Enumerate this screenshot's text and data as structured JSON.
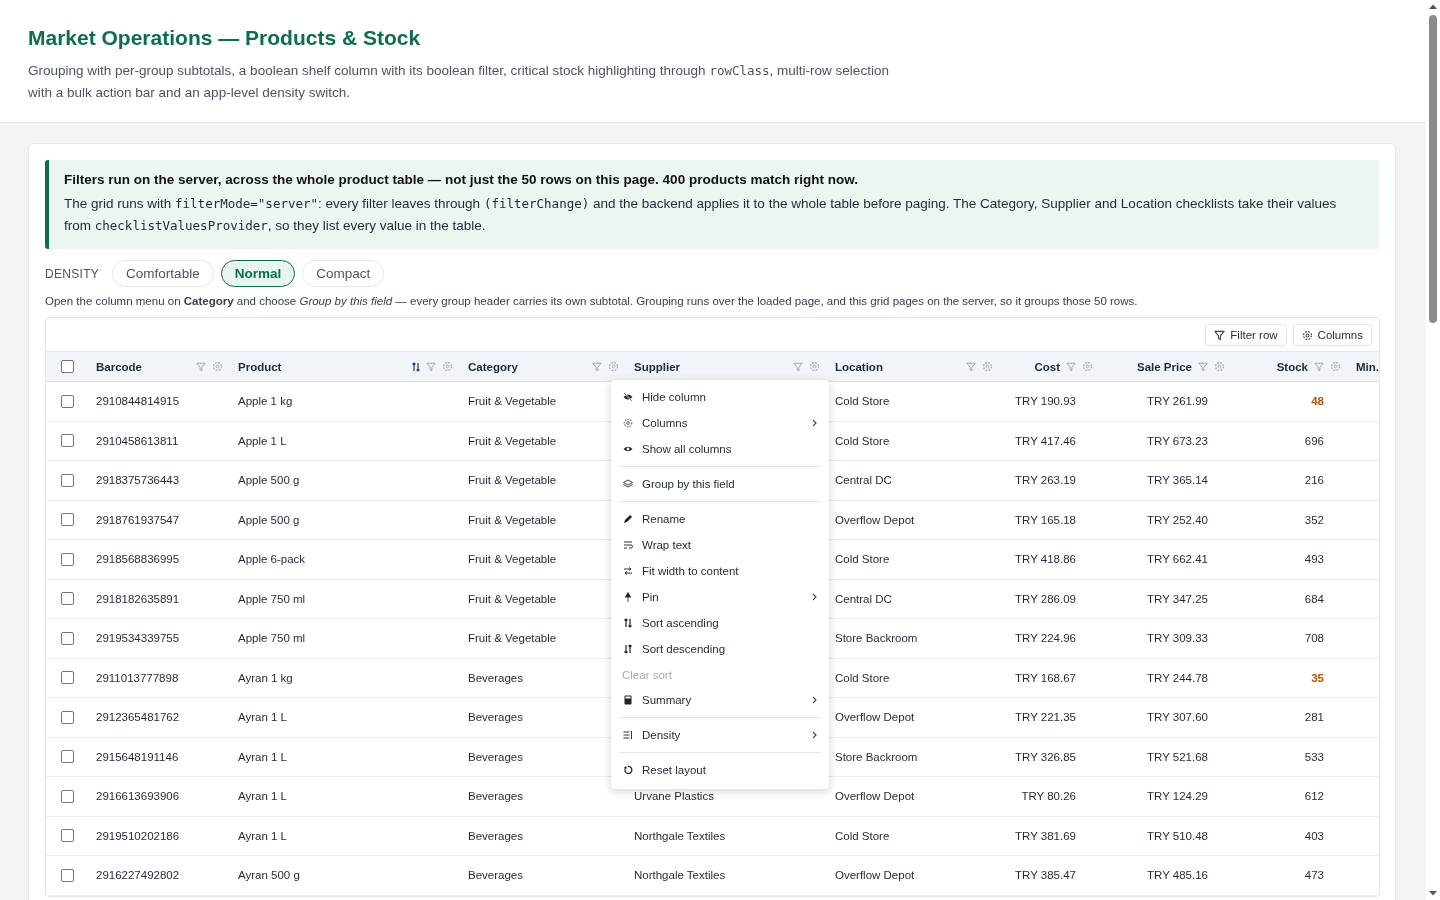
{
  "header": {
    "title": "Market Operations — Products & Stock",
    "description": [
      {
        "kind": "text",
        "text": "Grouping with per-group subtotals, a boolean shelf column with its boolean filter, critical stock highlighting through "
      },
      {
        "kind": "code",
        "text": "rowClass"
      },
      {
        "kind": "text",
        "text": ", multi-row selection with a bulk action bar and an app-level density switch."
      }
    ]
  },
  "notice": {
    "heading": "Filters run on the server, across the whole product table — not just the 50 rows on this page. 400 products match right now.",
    "body": [
      {
        "kind": "text",
        "text": "The grid runs with "
      },
      {
        "kind": "code",
        "text": "filterMode=\"server\""
      },
      {
        "kind": "text",
        "text": ": every filter leaves through "
      },
      {
        "kind": "code",
        "text": "(filterChange)"
      },
      {
        "kind": "text",
        "text": " and the backend applies it to the whole table before paging. The Category, Supplier and Location checklists take their values from "
      },
      {
        "kind": "code",
        "text": "checklistValuesProvider"
      },
      {
        "kind": "text",
        "text": ", so they list every value in the table."
      }
    ]
  },
  "density": {
    "label": "DENSITY",
    "options": [
      {
        "label": "Comfortable",
        "selected": false
      },
      {
        "label": "Normal",
        "selected": true
      },
      {
        "label": "Compact",
        "selected": false
      }
    ]
  },
  "hint": "Open the column menu on **Category** and choose *Group by this field* — every group header carries its own subtotal. Grouping runs over the loaded page, and this grid pages on the server, so it groups those 50 rows.",
  "toolbar": {
    "buttons": [
      "Filter row",
      "Columns"
    ]
  },
  "table": {
    "select_all_checked": false,
    "columns": [
      {
        "label": "Barcode",
        "sorted": false
      },
      {
        "label": "Product",
        "sorted": true
      },
      {
        "label": "Category",
        "sorted": false
      },
      {
        "label": "Supplier",
        "sorted": false
      },
      {
        "label": "Location",
        "sorted": false
      },
      {
        "label": "Cost",
        "sorted": false
      },
      {
        "label": "Sale Price",
        "sorted": false
      },
      {
        "label": "Stock",
        "sorted": false
      },
      {
        "label": "Min.",
        "sorted": false
      }
    ],
    "rows": [
      {
        "selected": false,
        "critical": true,
        "cells": [
          "2910844814915",
          "Apple 1 kg",
          "Fruit & Vegetable",
          "",
          "Cold Store",
          "TRY 190.93",
          "TRY 261.99",
          "48"
        ]
      },
      {
        "selected": false,
        "critical": false,
        "cells": [
          "2910458613811",
          "Apple 1 L",
          "Fruit & Vegetable",
          "",
          "Cold Store",
          "TRY 417.46",
          "TRY 673.23",
          "696"
        ]
      },
      {
        "selected": false,
        "critical": false,
        "cells": [
          "2918375736443",
          "Apple 500 g",
          "Fruit & Vegetable",
          "",
          "Central DC",
          "TRY 263.19",
          "TRY 365.14",
          "216"
        ]
      },
      {
        "selected": false,
        "critical": false,
        "cells": [
          "2918761937547",
          "Apple 500 g",
          "Fruit & Vegetable",
          "",
          "Overflow Depot",
          "TRY 165.18",
          "TRY 252.40",
          "352"
        ]
      },
      {
        "selected": false,
        "critical": false,
        "cells": [
          "2918568836995",
          "Apple 6-pack",
          "Fruit & Vegetable",
          "",
          "Cold Store",
          "TRY 418.86",
          "TRY 662.41",
          "493"
        ]
      },
      {
        "selected": false,
        "critical": false,
        "cells": [
          "2918182635891",
          "Apple 750 ml",
          "Fruit & Vegetable",
          "",
          "Central DC",
          "TRY 286.09",
          "TRY 347.25",
          "684"
        ]
      },
      {
        "selected": false,
        "critical": false,
        "cells": [
          "2919534339755",
          "Apple 750 ml",
          "Fruit & Vegetable",
          "",
          "Store Backroom",
          "TRY 224.96",
          "TRY 309.33",
          "708"
        ]
      },
      {
        "selected": false,
        "critical": true,
        "cells": [
          "2911013777898",
          "Ayran 1 kg",
          "Beverages",
          "",
          "Cold Store",
          "TRY 168.67",
          "TRY 244.78",
          "35"
        ]
      },
      {
        "selected": false,
        "critical": false,
        "cells": [
          "2912365481762",
          "Ayran 1 L",
          "Beverages",
          "",
          "Overflow Depot",
          "TRY 221.35",
          "TRY 307.60",
          "281"
        ]
      },
      {
        "selected": false,
        "critical": false,
        "cells": [
          "2915648191146",
          "Ayran 1 L",
          "Beverages",
          "",
          "Store Backroom",
          "TRY 326.85",
          "TRY 521.68",
          "533"
        ]
      },
      {
        "selected": false,
        "critical": false,
        "cells": [
          "2916613693906",
          "Ayran 1 L",
          "Beverages",
          "Urvane Plastics",
          "Overflow Depot",
          "TRY 80.26",
          "TRY 124.29",
          "612"
        ]
      },
      {
        "selected": false,
        "critical": false,
        "cells": [
          "2919510202186",
          "Ayran 1 L",
          "Beverages",
          "Northgale Textiles",
          "Cold Store",
          "TRY 381.69",
          "TRY 510.48",
          "403"
        ]
      },
      {
        "selected": false,
        "critical": false,
        "cells": [
          "2916227492802",
          "Ayran 500 g",
          "Beverages",
          "Northgale Textiles",
          "Overflow Depot",
          "TRY 385.47",
          "TRY 485.16",
          "473"
        ]
      }
    ]
  },
  "column_menu": {
    "groups": [
      [
        {
          "label": "Hide column",
          "submenu": false,
          "disabled": false
        },
        {
          "label": "Columns",
          "submenu": true,
          "disabled": false
        },
        {
          "label": "Show all columns",
          "submenu": false,
          "disabled": false
        }
      ],
      [
        {
          "label": "Group by this field",
          "submenu": false,
          "disabled": false
        }
      ],
      [
        {
          "label": "Rename",
          "submenu": false,
          "disabled": false
        },
        {
          "label": "Wrap text",
          "submenu": false,
          "disabled": false
        },
        {
          "label": "Fit width to content",
          "submenu": false,
          "disabled": false
        },
        {
          "label": "Pin",
          "submenu": true,
          "disabled": false
        },
        {
          "label": "Sort ascending",
          "submenu": false,
          "disabled": false
        },
        {
          "label": "Sort descending",
          "submenu": false,
          "disabled": false
        },
        {
          "label": "Clear sort",
          "submenu": false,
          "disabled": true
        },
        {
          "label": "Summary",
          "submenu": true,
          "disabled": false
        }
      ],
      [
        {
          "label": "Density",
          "submenu": true,
          "disabled": false
        }
      ],
      [
        {
          "label": "Reset layout",
          "submenu": false,
          "disabled": false
        }
      ]
    ]
  }
}
